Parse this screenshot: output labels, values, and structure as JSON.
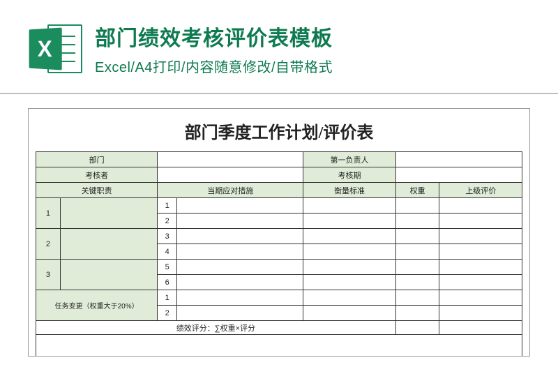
{
  "header": {
    "excel_letter": "X",
    "title": "部门绩效考核评价表模板",
    "subtitle": "Excel/A4打印/内容随意修改/自带格式"
  },
  "sheet": {
    "title": "部门季度工作计划/评价表",
    "info_row1": {
      "c1": "部门",
      "c2": "第一负责人"
    },
    "info_row2": {
      "c1": "考核者",
      "c2": "考核期"
    },
    "columns": {
      "key_duty": "关键职责",
      "measures": "当期应对措施",
      "criteria": "衡量标准",
      "weight": "权重",
      "review": "上级评价"
    },
    "row_nums": [
      "1",
      "2",
      "3"
    ],
    "sub_nums": [
      "1",
      "2",
      "3",
      "4",
      "5",
      "6"
    ],
    "task_change": "任务变更（权重大于20%）",
    "task_change_nums": [
      "1",
      "2"
    ],
    "score_label": "绩效评分：∑权重×评分"
  }
}
